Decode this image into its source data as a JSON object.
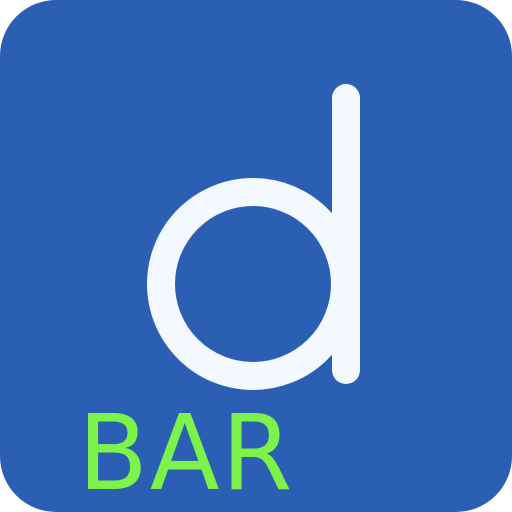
{
  "app_icon": {
    "name": "d",
    "badge_label": "BAR",
    "icon_semantic": "letter-d-icon",
    "colors": {
      "background": "#2a5fb4",
      "glyph": "#f4f8ff",
      "badge_text": "#7cf24a"
    }
  }
}
